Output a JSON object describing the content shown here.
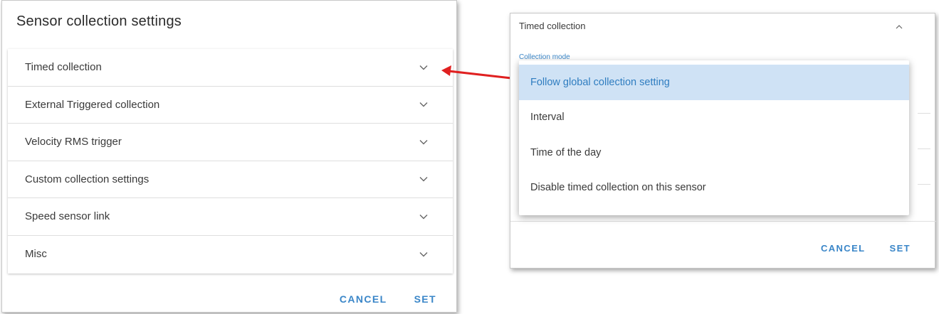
{
  "left_dialog": {
    "title": "Sensor collection settings",
    "sections": [
      {
        "label": "Timed collection"
      },
      {
        "label": "External Triggered collection"
      },
      {
        "label": "Velocity RMS trigger"
      },
      {
        "label": "Custom collection settings"
      },
      {
        "label": "Speed sensor link"
      },
      {
        "label": "Misc"
      }
    ],
    "cancel_label": "CANCEL",
    "set_label": "SET"
  },
  "right_dialog": {
    "section_label": "Timed collection",
    "field_label": "Collection mode",
    "options": [
      {
        "label": "Follow global collection setting",
        "selected": true
      },
      {
        "label": "Interval",
        "selected": false
      },
      {
        "label": "Time of the day",
        "selected": false
      },
      {
        "label": "Disable timed collection on this sensor",
        "selected": false
      }
    ],
    "cancel_label": "CANCEL",
    "set_label": "SET"
  },
  "colors": {
    "accent": "#3a86c8",
    "selected_bg": "#cfe2f5",
    "arrow": "#e02020"
  },
  "icons": {
    "expand": "chevron-down-icon",
    "collapse": "chevron-up-icon"
  }
}
